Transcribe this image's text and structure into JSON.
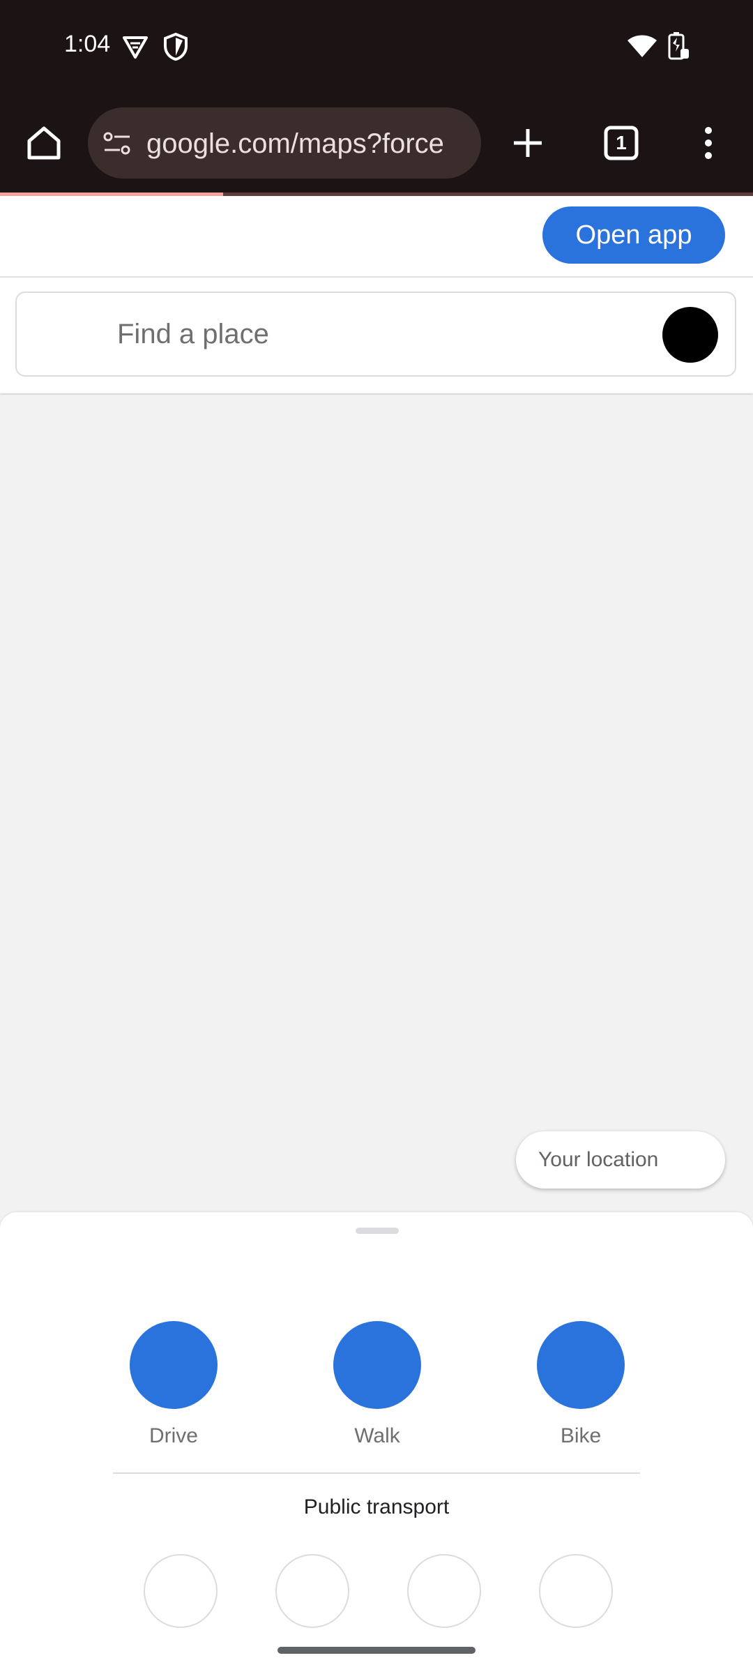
{
  "status_bar": {
    "time": "1:04",
    "icons": [
      "vpn-key-icon",
      "shield-icon",
      "wifi-icon",
      "battery-icon"
    ]
  },
  "browser": {
    "url": "google.com/maps?force",
    "tab_count": "1",
    "icons": [
      "home-icon",
      "site-settings-icon",
      "new-tab-icon",
      "tab-switcher-icon",
      "more-menu-icon"
    ]
  },
  "header": {
    "open_app_label": "Open app"
  },
  "search": {
    "placeholder": "Find a place"
  },
  "map": {
    "your_location_label": "Your location"
  },
  "travel_modes": [
    {
      "label": "Drive"
    },
    {
      "label": "Walk"
    },
    {
      "label": "Bike"
    }
  ],
  "public_transport": {
    "title": "Public transport"
  },
  "colors": {
    "accent": "#2a73dc",
    "chrome_toolbar": "#1c1314"
  }
}
